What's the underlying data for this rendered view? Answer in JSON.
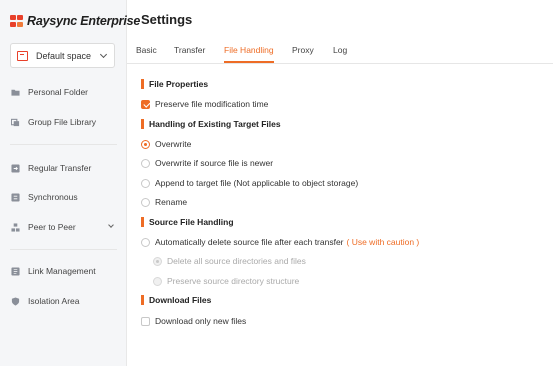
{
  "app": {
    "name": "Raysync Enterprise"
  },
  "space_selector": {
    "value": "Default space"
  },
  "sidebar": {
    "items": [
      {
        "label": "Personal Folder",
        "icon": "folder-icon"
      },
      {
        "label": "Group File Library",
        "icon": "library-icon"
      },
      {
        "label": "Regular Transfer",
        "icon": "transfer-icon"
      },
      {
        "label": "Synchronous",
        "icon": "sync-icon"
      },
      {
        "label": "Peer to Peer",
        "icon": "peer-icon"
      },
      {
        "label": "Link Management",
        "icon": "link-icon"
      },
      {
        "label": "Isolation Area",
        "icon": "shield-icon"
      }
    ]
  },
  "settings": {
    "title": "Settings",
    "tabs": [
      {
        "label": "Basic"
      },
      {
        "label": "Transfer"
      },
      {
        "label": "File Handling",
        "active": true
      },
      {
        "label": "Proxy"
      },
      {
        "label": "Log"
      }
    ],
    "sections": {
      "file_properties": {
        "title": "File Properties",
        "preserve_time": {
          "label": "Preserve file modification time",
          "checked": true
        }
      },
      "existing_target": {
        "title": "Handling of Existing Target Files",
        "options": [
          {
            "label": "Overwrite",
            "selected": true
          },
          {
            "label": "Overwrite if source file is newer",
            "selected": false
          },
          {
            "label": "Append to target file (Not applicable to object storage)",
            "selected": false
          },
          {
            "label": "Rename",
            "selected": false
          }
        ]
      },
      "source_handling": {
        "title": "Source File Handling",
        "auto_delete": {
          "label": "Automatically delete source file after each transfer",
          "caution": "( Use with caution )",
          "checked": false
        },
        "sub_options": [
          {
            "label": "Delete all source directories and files",
            "selected": true,
            "disabled": true
          },
          {
            "label": "Preserve source directory structure",
            "selected": false,
            "disabled": true
          }
        ]
      },
      "download_files": {
        "title": "Download Files",
        "only_new": {
          "label": "Download only new files",
          "checked": false
        }
      }
    }
  },
  "colors": {
    "accent": "#ee6c25",
    "brand": "#e8402a",
    "sidebar_bg": "#f5f6f8"
  }
}
